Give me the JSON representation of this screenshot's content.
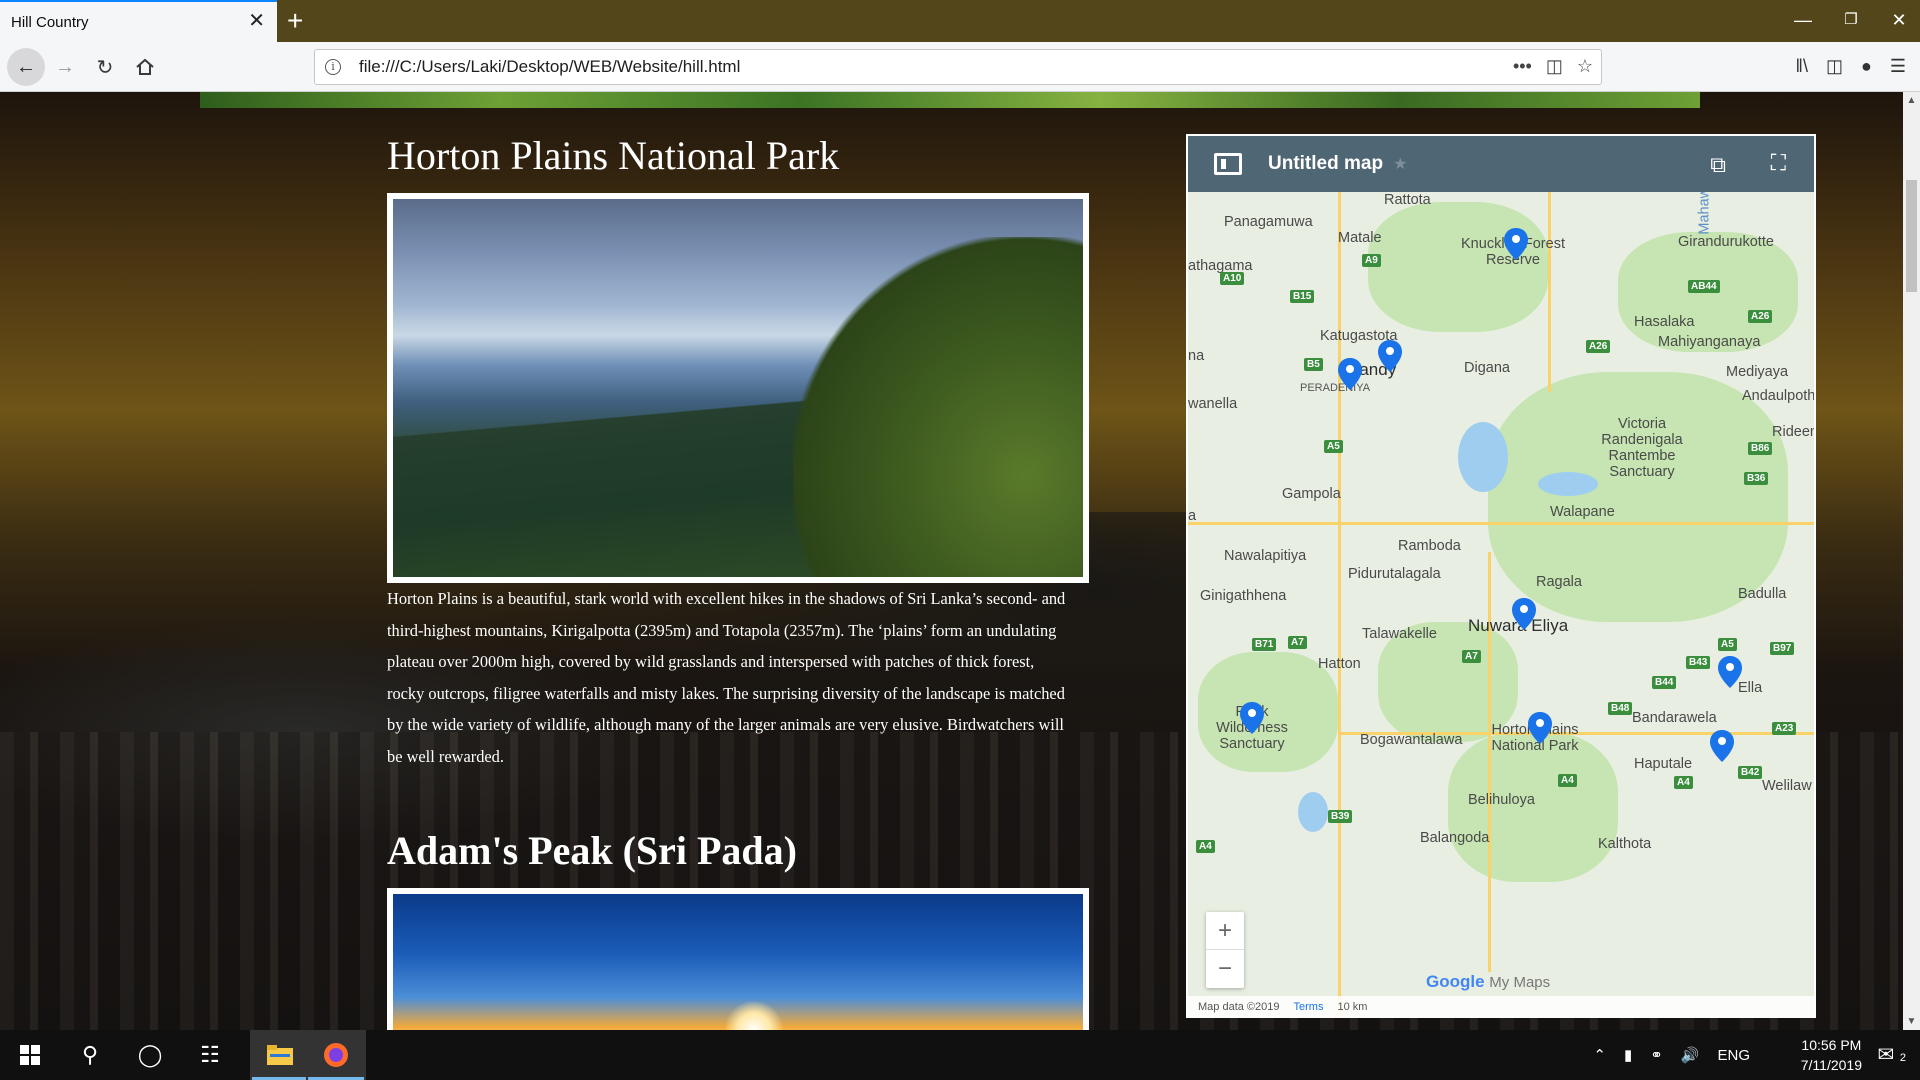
{
  "browser": {
    "tab_title": "Hill Country",
    "tab_close": "✕",
    "new_tab": "+",
    "url": "file:///C:/Users/Laki/Desktop/WEB/Website/hill.html",
    "window_min": "—",
    "window_restore": "❐",
    "window_close": "✕",
    "url_more": "•••"
  },
  "page": {
    "section1": {
      "title": "Horton Plains National Park",
      "description": "Horton Plains is a beautiful, stark world with excellent hikes in the shadows of Sri Lanka’s second- and third-highest mountains, Kirigalpotta (2395m) and Totapola (2357m). The ‘plains’ form an undulating plateau over 2000m high, covered by wild grasslands and interspersed with patches of thick forest, rocky outcrops, filigree waterfalls and misty lakes. The surprising diversity of the landscape is matched by the wide variety of wildlife, although many of the larger animals are very elusive. Birdwatchers will be well rewarded."
    },
    "section2": {
      "title": "Adam's Peak (Sri Pada)"
    }
  },
  "map": {
    "title": "Untitled map",
    "star": "★",
    "zoom_in": "+",
    "zoom_out": "−",
    "attribution": "Map data ©2019",
    "terms": "Terms",
    "scale": "10 km",
    "logo_google": "Google",
    "logo_mymaps": "My Maps",
    "places": [
      "Rattota",
      "Panagamuwa",
      "Matale",
      "Knuckles Forest Reserve",
      "Girandurukotte",
      "athagama",
      "Hasalaka",
      "Mahiyanganaya",
      "Katugastota",
      "Kandy",
      "Digana",
      "PERADENIYA",
      "Mediyaya",
      "Andaulpoth",
      "na",
      "wanella",
      "Victoria Randenigala Rantembe Sanctuary",
      "Rideen",
      "Gampola",
      "Walapane",
      "a",
      "Ramboda",
      "Nawalapitiya",
      "Pidurutalagala",
      "Ragala",
      "Ginigathhena",
      "Badulla",
      "Nuwara Eliya",
      "Talawakelle",
      "Hatton",
      "Ella",
      "Peak Wilderness Sanctuary",
      "Horton Plains National Park",
      "Bandarawela",
      "Bogawantalawa",
      "Haputale",
      "Welilaw",
      "Belihuloya",
      "Balangoda",
      "Kalthota",
      "Mahaweli"
    ],
    "shields": [
      "A9",
      "A10",
      "B15",
      "B5",
      "A26",
      "AB44",
      "A26",
      "A5",
      "B86",
      "B36",
      "B71",
      "A7",
      "A7",
      "A5",
      "B97",
      "B43",
      "B44",
      "B48",
      "A23",
      "A4",
      "A4",
      "B42",
      "B39",
      "A4"
    ],
    "pin_color": "#1a73e8"
  },
  "taskbar": {
    "lang": "ENG",
    "time": "10:56 PM",
    "date": "7/11/2019",
    "notifications": "2"
  },
  "colors": {
    "accent": "#0a84ff",
    "tabbar": "#53461b",
    "map_header": "#4f6674"
  }
}
